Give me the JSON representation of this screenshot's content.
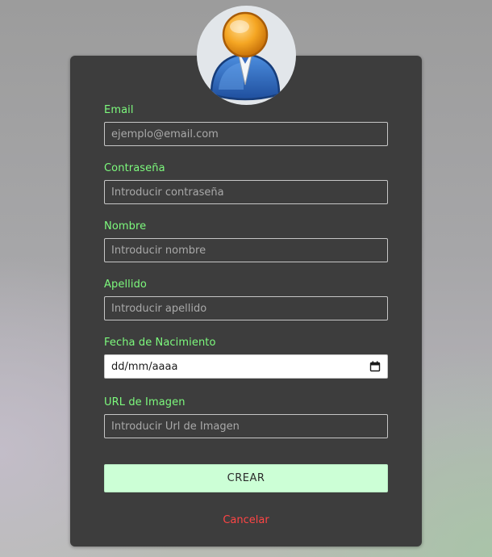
{
  "form": {
    "email": {
      "label": "Email",
      "placeholder": "ejemplo@email.com",
      "value": ""
    },
    "password": {
      "label": "Contraseña",
      "placeholder": "Introducir contraseña",
      "value": ""
    },
    "first_name": {
      "label": "Nombre",
      "placeholder": "Introducir nombre",
      "value": ""
    },
    "last_name": {
      "label": "Apellido",
      "placeholder": "Introducir apellido",
      "value": ""
    },
    "birth_date": {
      "label": "Fecha de Nacimiento",
      "value": "dd/mm/aaaa",
      "icon": "calendar-icon"
    },
    "image_url": {
      "label": "URL de Imagen",
      "placeholder": "Introducir Url de Imagen",
      "value": ""
    }
  },
  "actions": {
    "create_label": "CREAR",
    "cancel_label": "Cancelar"
  },
  "avatar": {
    "icon": "user-avatar-icon"
  },
  "colors": {
    "label": "#7dfa7d",
    "card": "#3d3d3d",
    "create_button": "#ccffd6",
    "cancel": "#ff4545"
  }
}
